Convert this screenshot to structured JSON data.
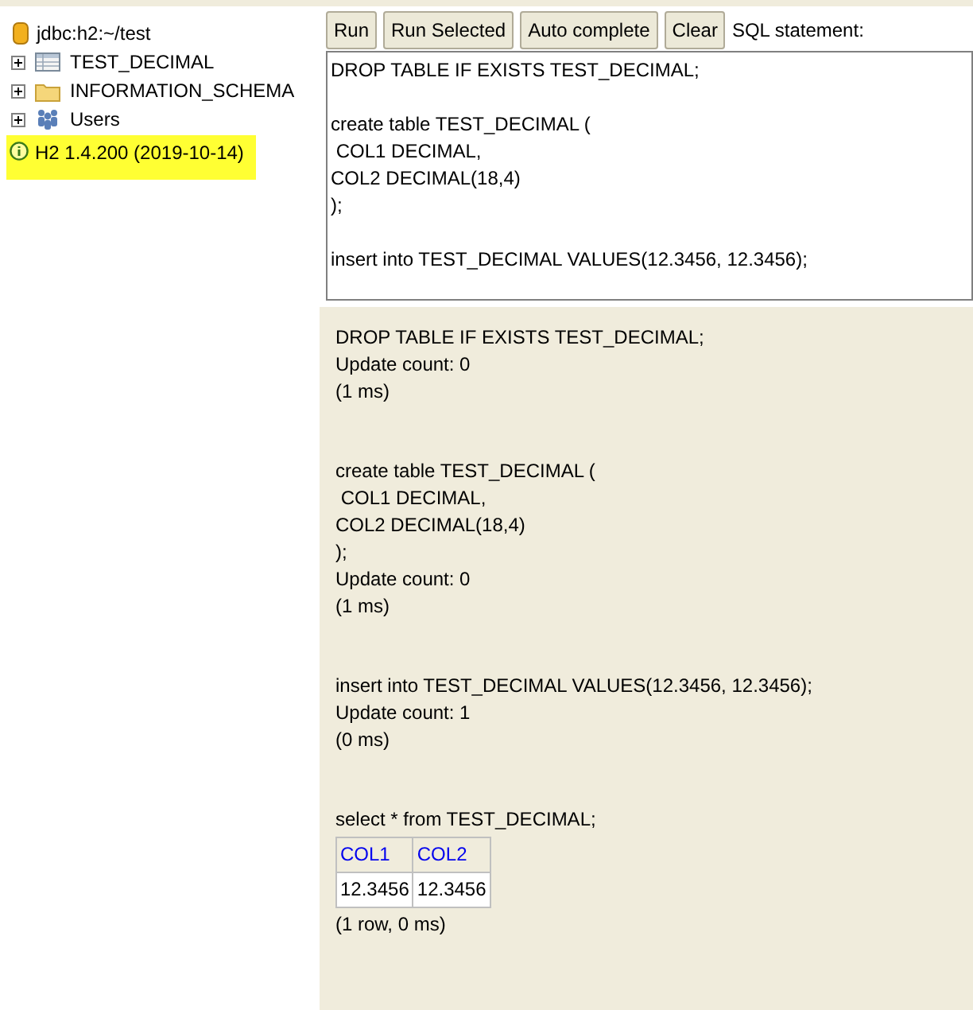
{
  "tree": {
    "connection": "jdbc:h2:~/test",
    "items": [
      {
        "label": "TEST_DECIMAL",
        "kind": "table"
      },
      {
        "label": "INFORMATION_SCHEMA",
        "kind": "folder"
      },
      {
        "label": "Users",
        "kind": "users"
      }
    ],
    "version": "H2 1.4.200 (2019-10-14)"
  },
  "toolbar": {
    "buttons": [
      "Run",
      "Run Selected",
      "Auto complete",
      "Clear"
    ],
    "label": "SQL statement:"
  },
  "editor": {
    "value": "DROP TABLE IF EXISTS TEST_DECIMAL;\n\ncreate table TEST_DECIMAL (\n COL1 DECIMAL,\nCOL2 DECIMAL(18,4)\n);\n\ninsert into TEST_DECIMAL VALUES(12.3456, 12.3456);"
  },
  "results": [
    {
      "kind": "update",
      "statement": "DROP TABLE IF EXISTS TEST_DECIMAL;",
      "lines": [
        "Update count: 0",
        "(1 ms)"
      ]
    },
    {
      "kind": "update",
      "statement": "create table TEST_DECIMAL (\n COL1 DECIMAL,\nCOL2 DECIMAL(18,4)\n);",
      "lines": [
        "Update count: 0",
        "(1 ms)"
      ]
    },
    {
      "kind": "update",
      "statement": "insert into TEST_DECIMAL VALUES(12.3456, 12.3456);",
      "lines": [
        "Update count: 1",
        "(0 ms)"
      ]
    },
    {
      "kind": "query",
      "statement": "select * from TEST_DECIMAL;",
      "columns": [
        "COL1",
        "COL2"
      ],
      "rows": [
        [
          "12.3456",
          "12.3456"
        ]
      ],
      "lines": [
        "(1 row, 0 ms)"
      ]
    }
  ]
}
